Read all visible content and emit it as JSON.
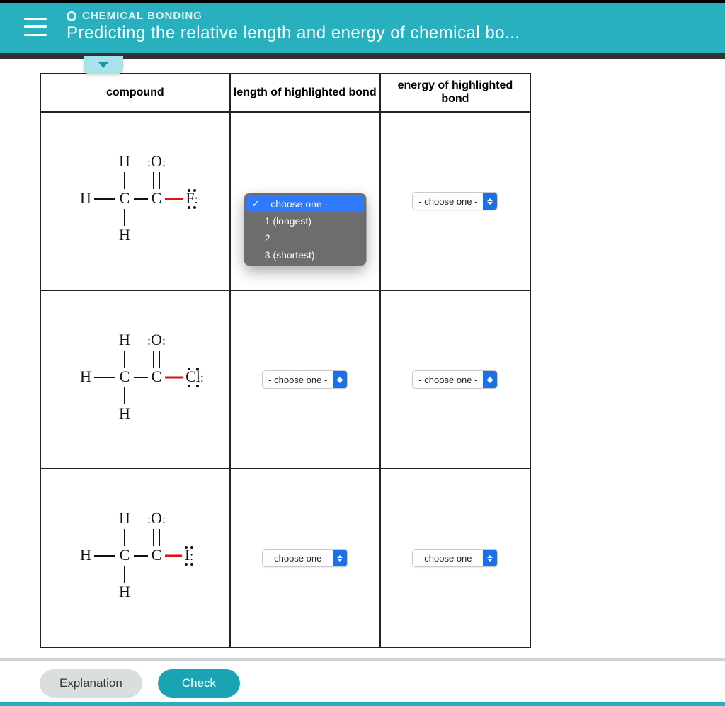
{
  "header": {
    "category": "CHEMICAL BONDING",
    "title": "Predicting the relative length and energy of chemical bo..."
  },
  "table": {
    "headers": {
      "compound": "compound",
      "length": "length of highlighted bond",
      "energy": "energy of highlighted bond"
    },
    "rows": [
      {
        "halogen": "F",
        "length_value": "- choose one -",
        "energy_value": "- choose one -"
      },
      {
        "halogen": "Cl",
        "length_value": "- choose one -",
        "energy_value": "- choose one -"
      },
      {
        "halogen": "I",
        "length_value": "- choose one -",
        "energy_value": "- choose one -"
      }
    ]
  },
  "dropdown": {
    "options": [
      "- choose one -",
      "1 (longest)",
      "2",
      "3 (shortest)"
    ],
    "selected": "- choose one -"
  },
  "footer": {
    "explanation_label": "Explanation",
    "check_label": "Check"
  }
}
